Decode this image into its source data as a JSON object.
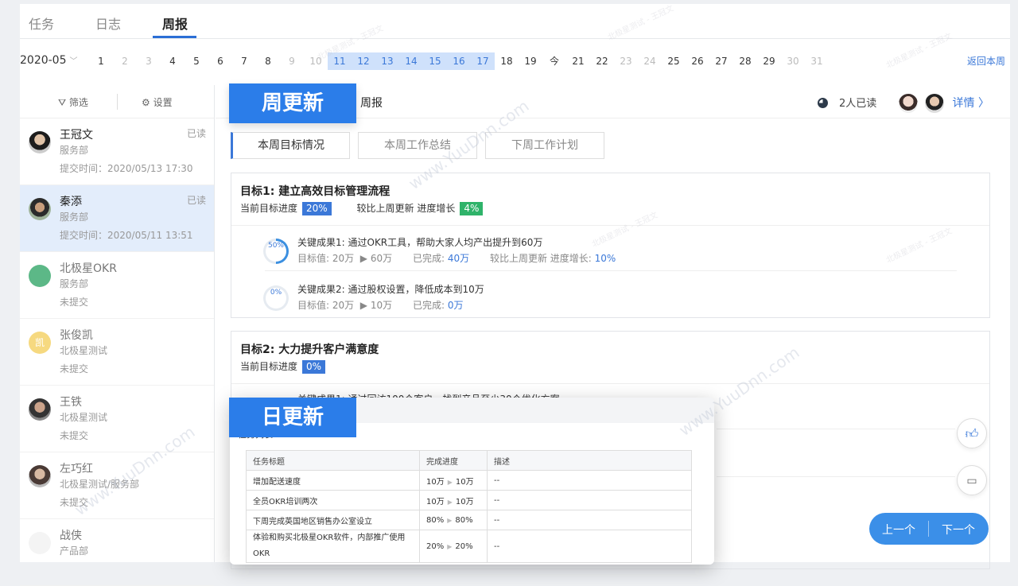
{
  "tabs": {
    "task": "任务",
    "log": "日志",
    "weekly": "周报"
  },
  "datebar": {
    "month": "2020-05",
    "days": [
      {
        "label": "1",
        "state": "normal"
      },
      {
        "label": "2",
        "state": "muted"
      },
      {
        "label": "3",
        "state": "muted"
      },
      {
        "label": "4",
        "state": "normal"
      },
      {
        "label": "5",
        "state": "normal"
      },
      {
        "label": "6",
        "state": "normal"
      },
      {
        "label": "7",
        "state": "normal"
      },
      {
        "label": "8",
        "state": "normal"
      },
      {
        "label": "9",
        "state": "muted"
      },
      {
        "label": "10",
        "state": "muted"
      },
      {
        "label": "11",
        "state": "sel"
      },
      {
        "label": "12",
        "state": "sel"
      },
      {
        "label": "13",
        "state": "sel"
      },
      {
        "label": "14",
        "state": "sel"
      },
      {
        "label": "15",
        "state": "sel"
      },
      {
        "label": "16",
        "state": "sel"
      },
      {
        "label": "17",
        "state": "sel"
      },
      {
        "label": "18",
        "state": "normal"
      },
      {
        "label": "19",
        "state": "normal"
      },
      {
        "label": "今",
        "state": "normal"
      },
      {
        "label": "21",
        "state": "normal"
      },
      {
        "label": "22",
        "state": "normal"
      },
      {
        "label": "23",
        "state": "muted"
      },
      {
        "label": "24",
        "state": "muted"
      },
      {
        "label": "25",
        "state": "normal"
      },
      {
        "label": "26",
        "state": "normal"
      },
      {
        "label": "27",
        "state": "normal"
      },
      {
        "label": "28",
        "state": "normal"
      },
      {
        "label": "29",
        "state": "normal"
      },
      {
        "label": "30",
        "state": "muted"
      },
      {
        "label": "31",
        "state": "muted"
      }
    ],
    "back": "返回本周"
  },
  "sidebar": {
    "filter": "筛选",
    "settings": "设置",
    "people": [
      {
        "name": "王冠文",
        "dept": "服务部",
        "time": "提交时间：2020/05/13 17:30",
        "read": "已读"
      },
      {
        "name": "秦添",
        "dept": "服务部",
        "time": "提交时间：2020/05/11 13:51",
        "read": "已读"
      },
      {
        "name": "北极星OKR",
        "dept": "服务部",
        "time": "未提交",
        "read": ""
      },
      {
        "name": "张俊凯",
        "dept": "北极星测试",
        "time": "未提交",
        "read": "",
        "initial": "凯"
      },
      {
        "name": "王铁",
        "dept": "北极星测试",
        "time": "未提交",
        "read": ""
      },
      {
        "name": "左巧红",
        "dept": "北极星测试/服务部",
        "time": "未提交",
        "read": ""
      },
      {
        "name": "战侠",
        "dept": "产品部",
        "time": "",
        "read": ""
      }
    ]
  },
  "main": {
    "title": "周报",
    "read_count": "2人已读",
    "detail": "详情 〉",
    "week_tabs": [
      "本周目标情况",
      "本周工作总结",
      "下周工作计划"
    ],
    "goal1": {
      "title": "目标1: 建立高效目标管理流程",
      "progress_label": "当前目标进度",
      "progress": "20%",
      "compare_label": "较比上周更新 进度增长",
      "growth": "4%",
      "krs": [
        {
          "ring": "50%",
          "title": "关键成果1: 通过OKR工具，帮助大家人均产出提升到60万",
          "target": "目标值: 20万",
          "arrow": "▶",
          "target_to": "60万",
          "done_label": "已完成:",
          "done": "40万",
          "cmp_label": "较比上周更新 进度增长:",
          "cmp": "10%"
        },
        {
          "ring": "0%",
          "title": "关键成果2: 通过股权设置，降低成本到10万",
          "target": "目标值: 20万",
          "arrow": "▶",
          "target_to": "10万",
          "done_label": "已完成:",
          "done": "0万"
        }
      ]
    },
    "goal2": {
      "title": "目标2: 大力提升客户满意度",
      "progress_label": "当前目标进度",
      "progress": "0%",
      "kr_partial": "关键成果1: 通过回访100个客户，找到产品至少30个优化方案"
    }
  },
  "labels": {
    "week_update": "周更新",
    "day_update": "日更新"
  },
  "popup": {
    "subtitle": "任务列表",
    "headers": [
      "任务标题",
      "完成进度",
      "描述"
    ],
    "rows": [
      {
        "title": "增加配送速度",
        "from": "10万",
        "to": "10万",
        "desc": "--"
      },
      {
        "title": "全员OKR培训两次",
        "from": "10万",
        "to": "10万",
        "desc": "--"
      },
      {
        "title": "下周完成英国地区销售办公室设立",
        "from": "80%",
        "to": "80%",
        "desc": "--"
      },
      {
        "title": "体验和购买北极星OKR软件，内部推广使用OKR",
        "from": "20%",
        "to": "20%",
        "desc": "--"
      }
    ]
  },
  "nav": {
    "prev": "上一个",
    "next": "下一个"
  },
  "watermarks": {
    "site": "www.YuuDnn.com",
    "small": "北极星测试 - 王冠文"
  },
  "colors": {
    "accent": "#3b78d8",
    "label_bg": "#2b7de9",
    "growth": "#2fb36a"
  }
}
